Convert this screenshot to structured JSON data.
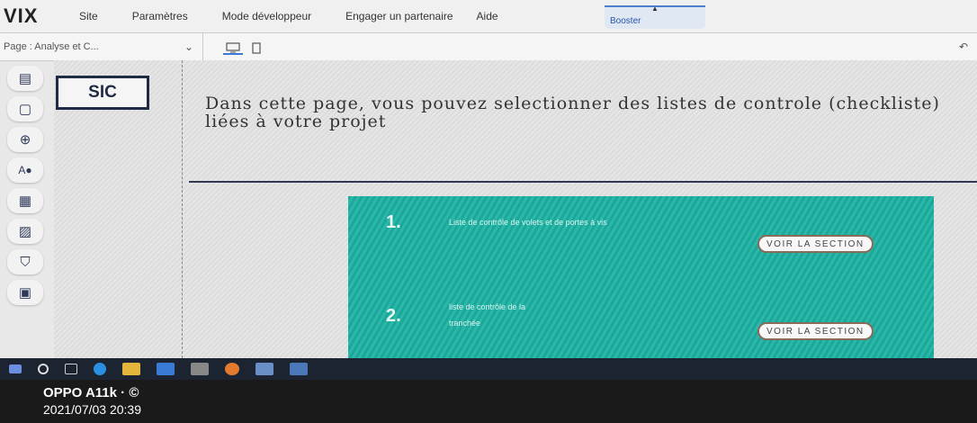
{
  "topbar": {
    "logo": "VIX",
    "menu": [
      "Site",
      "Paramètres",
      "Mode développeur",
      "Engager un partenaire",
      "Aide"
    ],
    "booster": "Booster"
  },
  "subbar": {
    "page_label": "Page : Analyse et C..."
  },
  "sidebar": {
    "icons": [
      "pages-icon",
      "layout-icon",
      "add-icon",
      "design-icon",
      "apps-icon",
      "media-icon",
      "store-icon",
      "portfolio-icon"
    ]
  },
  "canvas": {
    "logo": "SIC",
    "headline": "Dans cette page, vous pouvez selectionner des listes de controle (checkliste)  liées à votre projet",
    "items": [
      {
        "num": "1.",
        "text": "Liste de contrôle  de volets et de portes à vis",
        "button": "VOIR LA SECTION"
      },
      {
        "num": "2.",
        "text": "liste de contrôle de la tranchée",
        "button": "VOIR LA SECTION"
      }
    ]
  },
  "watermark": {
    "device": "OPPO A11k · ©",
    "datetime": "2021/07/03 20:39"
  },
  "colors": {
    "panel": "#1ba79a",
    "accent": "#3a7bd5"
  }
}
